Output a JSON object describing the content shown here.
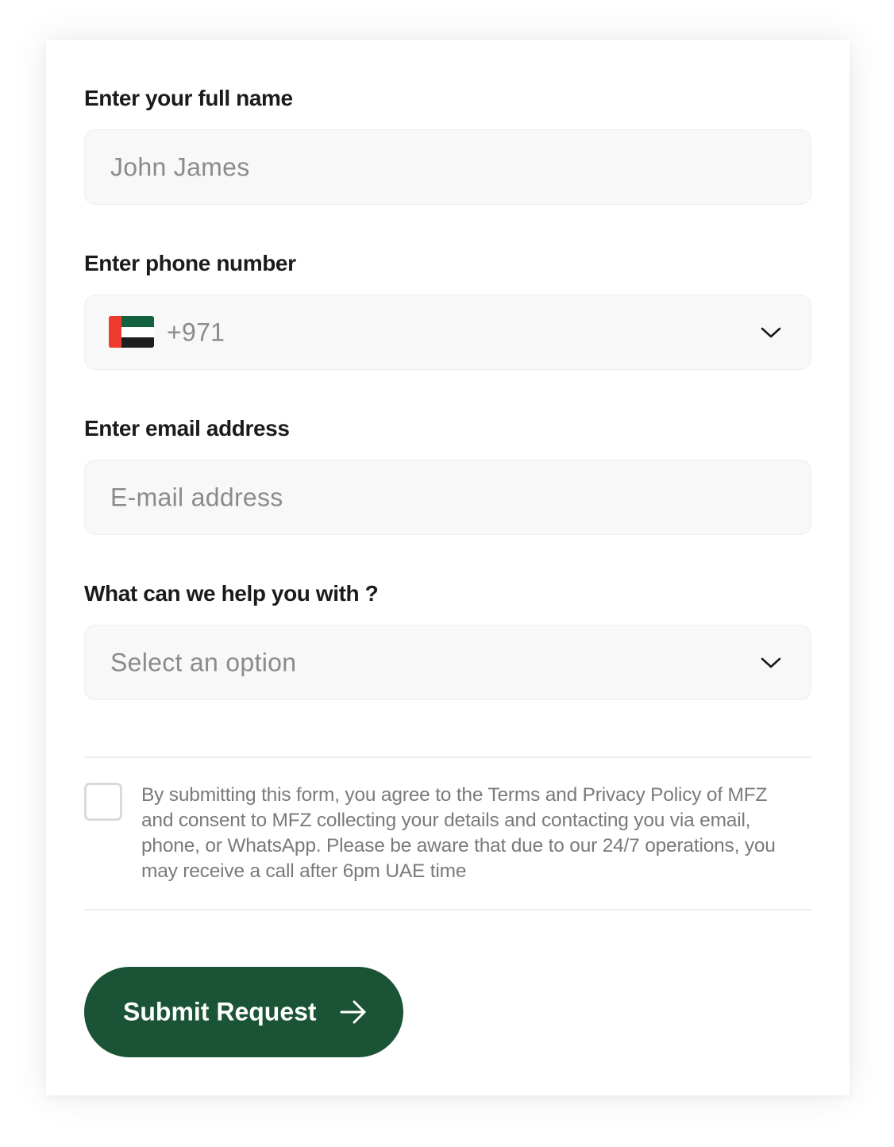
{
  "form": {
    "full_name": {
      "label": "Enter your full name",
      "placeholder": "John James"
    },
    "phone": {
      "label": "Enter phone number",
      "country_flag": "uae-flag-icon",
      "country_code": "+971",
      "dropdown_icon": "chevron-down-icon"
    },
    "email": {
      "label": "Enter email address",
      "placeholder": "E-mail address"
    },
    "help_topic": {
      "label": "What can we help you with ?",
      "placeholder": "Select an option",
      "dropdown_icon": "chevron-down-icon"
    },
    "consent": {
      "checked": false,
      "text": "By submitting this form, you agree to the Terms and Privacy Policy of MFZ and consent to MFZ  collecting your details and contacting you via email, phone, or WhatsApp. Please be aware that due to our 24/7 operations, you may receive a call after 6pm UAE time"
    },
    "submit": {
      "label": "Submit Request",
      "icon": "arrow-right-icon"
    }
  },
  "colors": {
    "primary_green": "#1b5336",
    "field_background": "#f8f8f8",
    "placeholder_text": "#8b8b8b",
    "label_text": "#1b1b1b"
  }
}
